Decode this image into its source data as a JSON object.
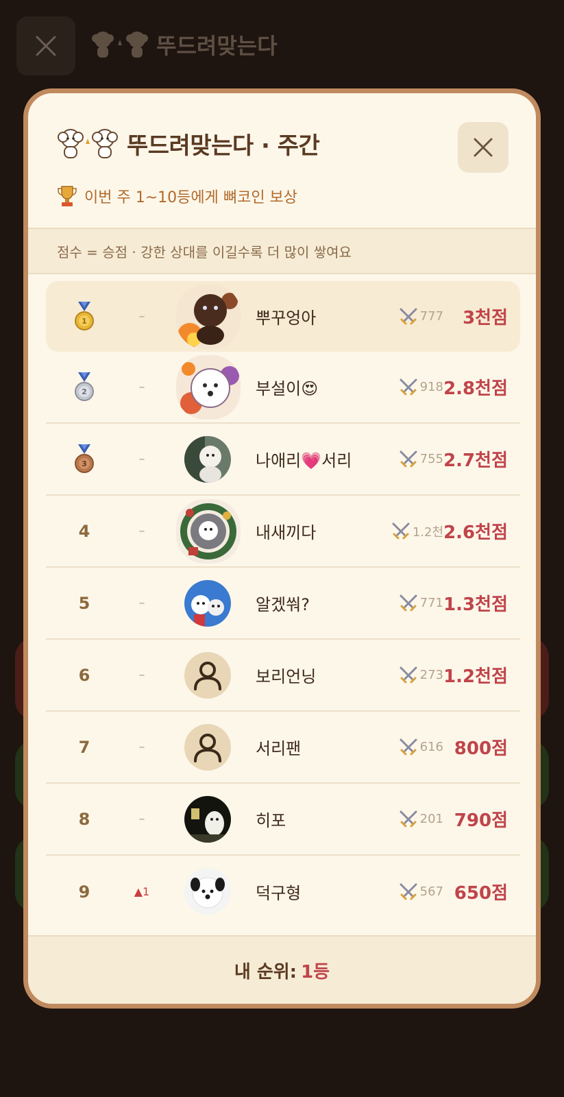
{
  "background": {
    "title": "뚜드려맞는다"
  },
  "modal": {
    "title": "뚜드려맞는다 · 주간",
    "reward": "이번 주 1~10등에게 뼈코인 보상",
    "notice": "점수 = 승점 · 강한 상대를 이길수록 더 많이 쌓여요",
    "footer_label": "내 순위:",
    "footer_value": "1등"
  },
  "icons": {
    "close": "close-icon",
    "swords": "crossed-swords-icon",
    "trophy": "trophy-icon",
    "medals": [
      "gold-medal-icon",
      "silver-medal-icon",
      "bronze-medal-icon"
    ]
  },
  "rankings": [
    {
      "rank": "1",
      "change": "–",
      "name": "뿌꾸엉아",
      "battles": "777",
      "score": "3천점"
    },
    {
      "rank": "2",
      "change": "–",
      "name": "부설이😍",
      "battles": "918",
      "score": "2.8천점"
    },
    {
      "rank": "3",
      "change": "–",
      "name": "나애리💗서리",
      "battles": "755",
      "score": "2.7천점"
    },
    {
      "rank": "4",
      "change": "–",
      "name": "내새끼다",
      "battles": "1.2천",
      "score": "2.6천점"
    },
    {
      "rank": "5",
      "change": "–",
      "name": "알겠쒀?",
      "battles": "771",
      "score": "1.3천점"
    },
    {
      "rank": "6",
      "change": "–",
      "name": "보리언닝",
      "battles": "273",
      "score": "1.2천점"
    },
    {
      "rank": "7",
      "change": "–",
      "name": "서리팬",
      "battles": "616",
      "score": "800점"
    },
    {
      "rank": "8",
      "change": "–",
      "name": "히포",
      "battles": "201",
      "score": "790점"
    },
    {
      "rank": "9",
      "change": "▲1",
      "name": "덕구형",
      "battles": "567",
      "score": "650점"
    }
  ],
  "colors": {
    "score": "#c0444a",
    "modal_border": "#c08a5f",
    "modal_bg": "#fdf7ea"
  }
}
